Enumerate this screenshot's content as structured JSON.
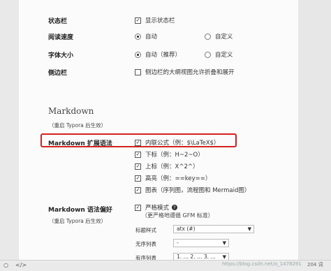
{
  "settings": {
    "statusbar": {
      "label": "状态栏",
      "option": "显示状态栏"
    },
    "reading_speed": {
      "label": "阅读速度",
      "auto": "自动",
      "custom": "自定义"
    },
    "font_size": {
      "label": "字体大小",
      "auto": "自动（推荐）",
      "custom": "自定义"
    },
    "sidebar": {
      "label": "侧边栏",
      "option": "侧边栏的大纲视图允许折叠和展开"
    }
  },
  "markdown": {
    "section_title": "Markdown",
    "restart_hint": "（重启 Typora 后生效）",
    "extensions": {
      "label": "Markdown 扩展语法",
      "inline_math": "内联公式（例：$\\LaTeX$）",
      "subscript": "下标（例：H~2~O）",
      "superscript": "上标（例：X^2^）",
      "highlight": "高亮（例：==key==）",
      "diagrams": "图表（序列图，流程图和 Mermaid图）"
    },
    "preferences": {
      "label": "Markdown 语法偏好",
      "restart_hint": "（重启 Typora 后生效）",
      "strict_mode": "严格模式",
      "strict_desc": "（更严格地遵循 GFM 标准）",
      "heading_style_label": "标题样式",
      "heading_style_value": "atx (#)",
      "unordered_list_label": "无序列表",
      "unordered_list_value": "-",
      "ordered_list_label": "有序列表",
      "ordered_list_value": "1. … 2. … 3. …"
    }
  },
  "bottom": {
    "watermark": "https://blog.csdn.net/a_1478291",
    "count": "204 词"
  }
}
